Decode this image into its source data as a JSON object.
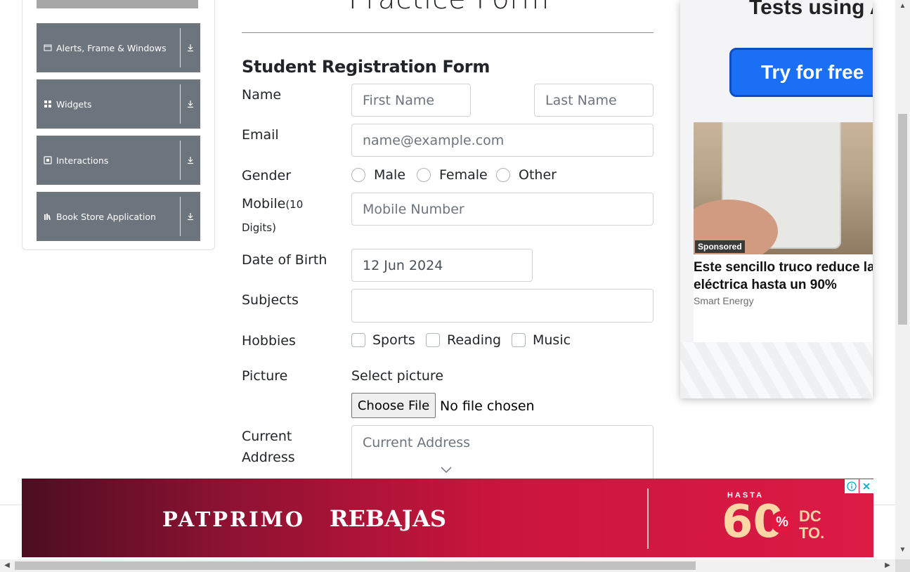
{
  "page": {
    "title": "Practice Form",
    "form_title": "Student Registration Form"
  },
  "sidebar": {
    "groups": [
      {
        "label": "Alerts, Frame & Windows",
        "icon": "window-icon"
      },
      {
        "label": "Widgets",
        "icon": "grid-icon"
      },
      {
        "label": "Interactions",
        "icon": "interactions-icon"
      },
      {
        "label": "Book Store Application",
        "icon": "books-icon"
      }
    ]
  },
  "form": {
    "name_label": "Name",
    "first_name_placeholder": "First Name",
    "last_name_placeholder": "Last Name",
    "email_label": "Email",
    "email_placeholder": "name@example.com",
    "gender_label": "Gender",
    "gender_options": [
      "Male",
      "Female",
      "Other"
    ],
    "mobile_label": "Mobile",
    "mobile_hint_line1": "(10",
    "mobile_hint_line2": "Digits)",
    "mobile_placeholder": "Mobile Number",
    "dob_label": "Date of Birth",
    "dob_value": "12 Jun 2024",
    "subjects_label": "Subjects",
    "subjects_value": "",
    "hobbies_label": "Hobbies",
    "hobbies_options": [
      "Sports",
      "Reading",
      "Music"
    ],
    "picture_label": "Picture",
    "select_picture_text": "Select picture",
    "choose_file_label": "Choose File",
    "no_file_text": "No file chosen",
    "address_label_line1": "Current",
    "address_label_line2": "Address",
    "address_placeholder": "Current Address"
  },
  "ads": {
    "right": {
      "top_text": "Tests using A",
      "button_text": "Try for free →",
      "sponsored_label": "Sponsored",
      "headline_line1": "Este sencillo truco reduce la fa",
      "headline_line2": "eléctrica hasta un 90%",
      "advertiser": "Smart Energy"
    },
    "bottom": {
      "brand": "PATPRIMO",
      "sale_text": "REBAJAS",
      "hasta": "HASTA",
      "discount": "60",
      "percent": "%",
      "dc_line1": "DC",
      "dc_line2": "TO."
    }
  },
  "colors": {
    "sidebar_group_bg": "#6c757d",
    "ad_bottom_accent": "#dc1b45",
    "ad_button_blue": "#1a6ff4"
  }
}
